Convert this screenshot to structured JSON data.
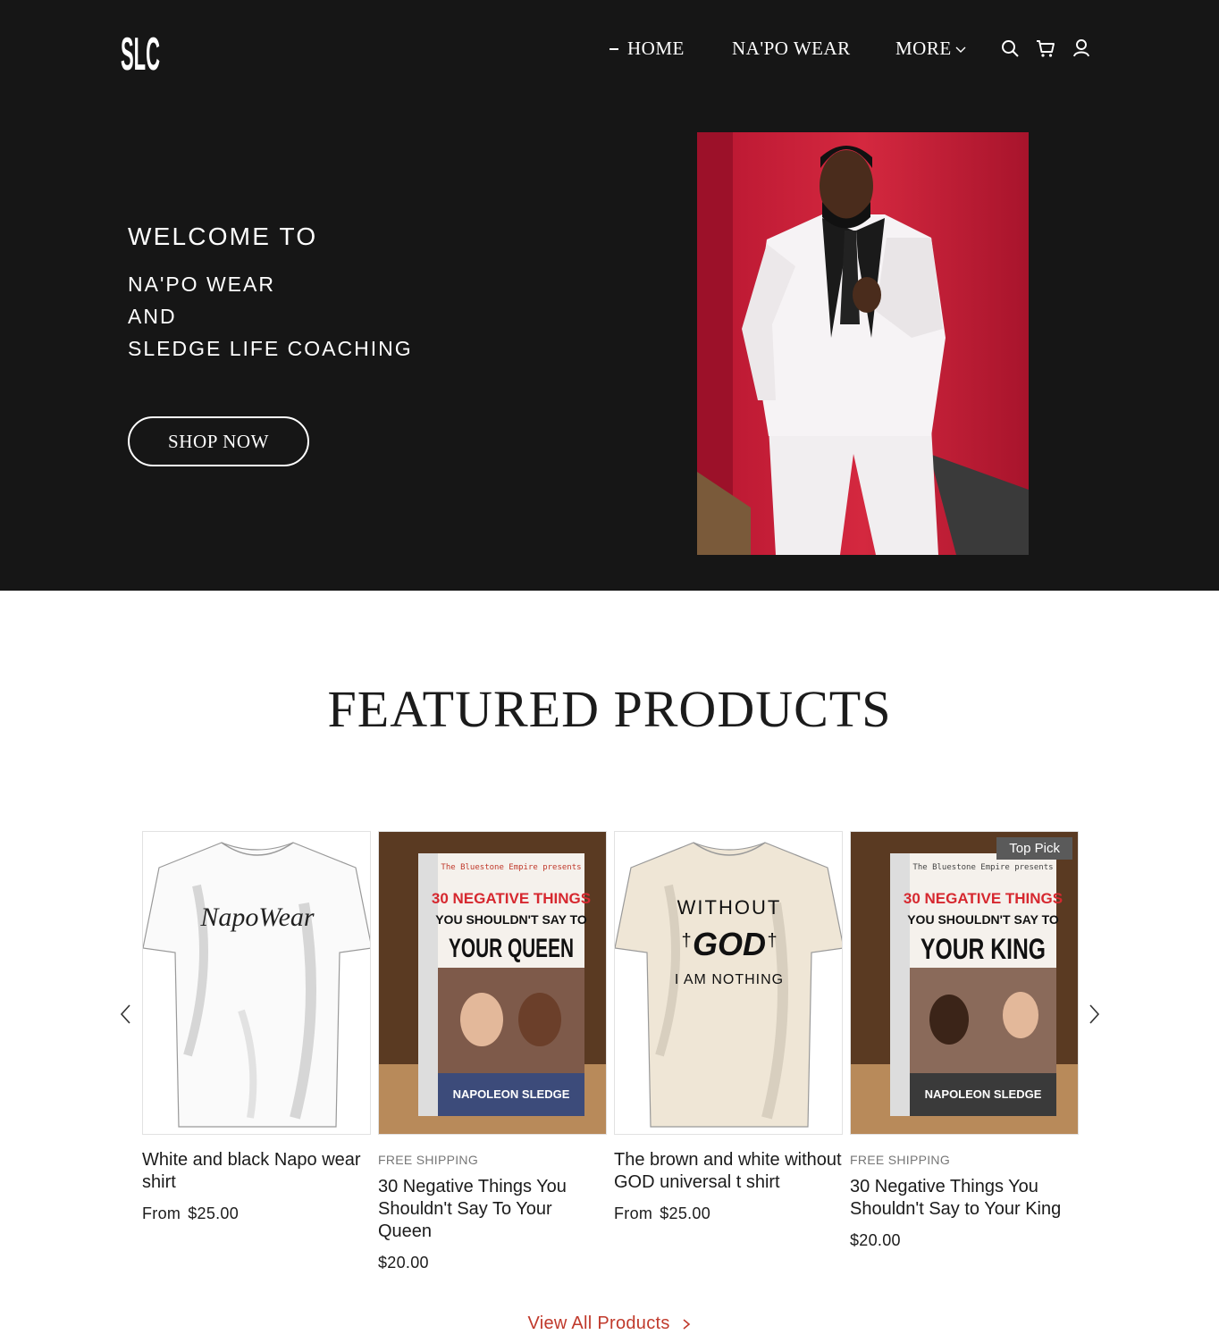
{
  "header": {
    "logo_alt": "SLC",
    "nav": [
      {
        "label": "HOME",
        "active": true
      },
      {
        "label": "NA'PO WEAR",
        "active": false
      },
      {
        "label": "MORE",
        "active": false
      }
    ],
    "icons": [
      "search-icon",
      "cart-icon",
      "account-icon"
    ]
  },
  "hero": {
    "welcome": "WELCOME TO",
    "line1": "NA'PO WEAR",
    "line2": "AND",
    "line3": "SLEDGE LIFE COACHING",
    "cta": "SHOP NOW",
    "bg_color": "#161616",
    "photo_bg": "#c4213a"
  },
  "featured": {
    "title": "FEATURED PRODUCTS",
    "products": [
      {
        "name": "White and black Napo wear shirt",
        "price_prefix": "From",
        "price": "$25.00",
        "shipping": "",
        "badge": "",
        "image_text": "NapoWear"
      },
      {
        "name": "30 Negative Things You Shouldn't Say To Your Queen",
        "price_prefix": "",
        "price": "$20.00",
        "shipping": "FREE SHIPPING",
        "badge": "",
        "book": {
          "top": "The Bluestone Empire presents",
          "l1": "30 NEGATIVE THINGS",
          "l2": "YOU SHOULDN'T SAY TO",
          "l3": "YOUR QUEEN",
          "author": "NAPOLEON SLEDGE"
        }
      },
      {
        "name": "The brown and white without GOD universal t shirt",
        "price_prefix": "From",
        "price": "$25.00",
        "shipping": "",
        "badge": "",
        "image_text": {
          "top": "WITHOUT",
          "mid": "GOD",
          "bottom": "I AM NOTHING"
        }
      },
      {
        "name": "30 Negative Things You Shouldn't Say to Your King",
        "price_prefix": "",
        "price": "$20.00",
        "shipping": "FREE SHIPPING",
        "badge": "Top Pick",
        "book": {
          "top": "The Bluestone Empire presents",
          "l1": "30 NEGATIVE THINGS",
          "l2": "YOU SHOULDN'T SAY TO",
          "l3": "YOUR KING",
          "author": "NAPOLEON SLEDGE"
        }
      }
    ],
    "view_all": "View All Products",
    "accent": "#c0392b"
  }
}
